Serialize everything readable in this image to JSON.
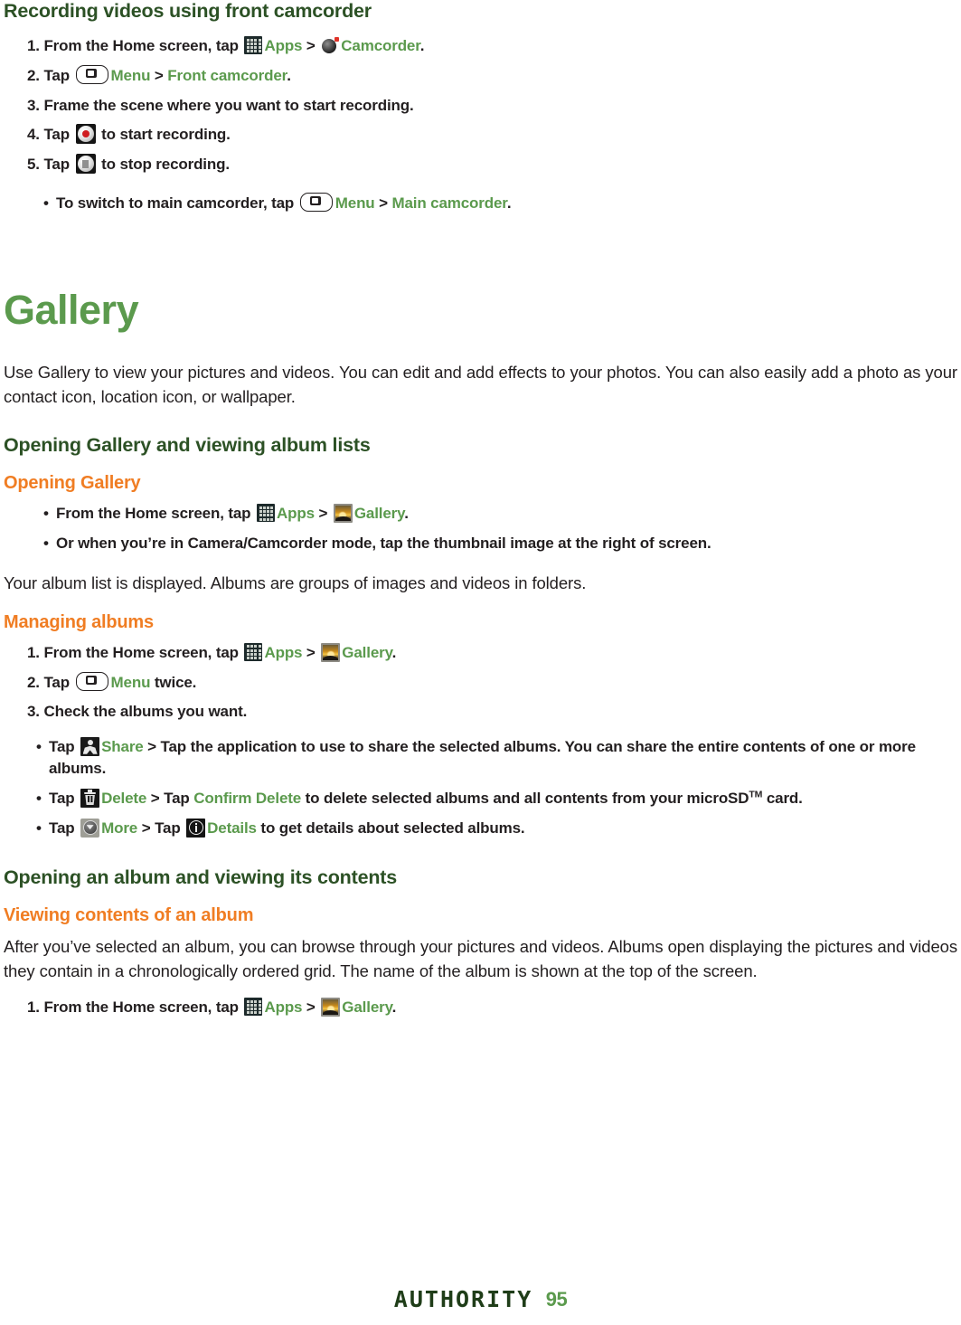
{
  "colors": {
    "heading_dark_green": "#2c5125",
    "chapter_green": "#5b9a4d",
    "orange": "#f07d23",
    "body_black": "#231f20"
  },
  "front_camcorder": {
    "heading": "Recording videos using front camcorder",
    "steps": [
      {
        "num": "1.",
        "parts": [
          {
            "t": "text",
            "v": "From the Home screen, tap "
          },
          {
            "t": "icon",
            "v": "apps-icon"
          },
          {
            "t": "green",
            "v": "Apps"
          },
          {
            "t": "sep",
            "v": " > "
          },
          {
            "t": "icon",
            "v": "camcorder-icon"
          },
          {
            "t": "green",
            "v": "Camcorder"
          },
          {
            "t": "text",
            "v": "."
          }
        ]
      },
      {
        "num": "2.",
        "parts": [
          {
            "t": "text",
            "v": "Tap "
          },
          {
            "t": "icon",
            "v": "menu-key-icon"
          },
          {
            "t": "green",
            "v": "Menu"
          },
          {
            "t": "sep",
            "v": " > "
          },
          {
            "t": "green",
            "v": "Front camcorder"
          },
          {
            "t": "text",
            "v": "."
          }
        ]
      },
      {
        "num": "3.",
        "parts": [
          {
            "t": "text",
            "v": "Frame the scene where you want to start recording."
          }
        ]
      },
      {
        "num": "4.",
        "parts": [
          {
            "t": "text",
            "v": "Tap "
          },
          {
            "t": "icon",
            "v": "record-button-icon"
          },
          {
            "t": "text",
            "v": " to start recording."
          }
        ]
      },
      {
        "num": "5.",
        "parts": [
          {
            "t": "text",
            "v": "Tap "
          },
          {
            "t": "icon",
            "v": "stop-button-icon"
          },
          {
            "t": "text",
            "v": " to stop recording."
          }
        ]
      }
    ],
    "bullet": {
      "dot": "•",
      "parts": [
        {
          "t": "text",
          "v": "To switch to main camcorder, tap "
        },
        {
          "t": "icon",
          "v": "menu-key-icon"
        },
        {
          "t": "green",
          "v": "Menu"
        },
        {
          "t": "sep",
          "v": " > "
        },
        {
          "t": "green",
          "v": "Main camcorder"
        },
        {
          "t": "text",
          "v": "."
        }
      ]
    }
  },
  "gallery": {
    "chapter_title": "Gallery",
    "intro": "Use Gallery to view your pictures and videos. You can edit and add effects to your photos. You can also easily add a photo as your contact icon, location icon, or wallpaper.",
    "section_opening": {
      "heading": "Opening Gallery and viewing album lists",
      "sub_heading": "Opening Gallery",
      "bullets": [
        {
          "dot": "•",
          "parts": [
            {
              "t": "text",
              "v": "From the Home screen, tap "
            },
            {
              "t": "icon",
              "v": "apps-icon"
            },
            {
              "t": "green",
              "v": "Apps"
            },
            {
              "t": "sep",
              "v": " > "
            },
            {
              "t": "icon",
              "v": "gallery-icon"
            },
            {
              "t": "green",
              "v": "Gallery"
            },
            {
              "t": "text",
              "v": "."
            }
          ]
        },
        {
          "dot": "•",
          "parts": [
            {
              "t": "text",
              "v": "Or when you’re in Camera/Camcorder mode, tap the thumbnail image at the right of screen."
            }
          ]
        }
      ],
      "after_text": "Your album list is displayed. Albums are groups of images and videos in folders."
    },
    "section_managing": {
      "sub_heading": "Managing albums",
      "steps": [
        {
          "num": "1.",
          "parts": [
            {
              "t": "text",
              "v": "From the Home screen, tap "
            },
            {
              "t": "icon",
              "v": "apps-icon"
            },
            {
              "t": "green",
              "v": "Apps"
            },
            {
              "t": "sep",
              "v": " > "
            },
            {
              "t": "icon",
              "v": "gallery-icon"
            },
            {
              "t": "green",
              "v": "Gallery"
            },
            {
              "t": "text",
              "v": "."
            }
          ]
        },
        {
          "num": "2.",
          "parts": [
            {
              "t": "text",
              "v": "Tap "
            },
            {
              "t": "icon",
              "v": "menu-key-icon"
            },
            {
              "t": "green",
              "v": "Menu"
            },
            {
              "t": "text",
              "v": " twice."
            }
          ]
        },
        {
          "num": "3.",
          "parts": [
            {
              "t": "text",
              "v": "Check the albums you want."
            }
          ]
        }
      ],
      "bullets": [
        {
          "dot": "•",
          "parts": [
            {
              "t": "text",
              "v": "Tap "
            },
            {
              "t": "icon",
              "v": "share-icon"
            },
            {
              "t": "green",
              "v": "Share"
            },
            {
              "t": "sep",
              "v": " > "
            },
            {
              "t": "text",
              "v": "Tap the application to use to share the selected albums. You can share the entire contents of one or more albums."
            }
          ]
        },
        {
          "dot": "•",
          "parts": [
            {
              "t": "text",
              "v": "Tap "
            },
            {
              "t": "icon",
              "v": "trash-icon"
            },
            {
              "t": "green",
              "v": "Delete"
            },
            {
              "t": "sep",
              "v": " > "
            },
            {
              "t": "text",
              "v": "Tap "
            },
            {
              "t": "green",
              "v": "Confirm Delete"
            },
            {
              "t": "text",
              "v": " to delete selected albums and all contents from your microSD"
            },
            {
              "t": "sup",
              "v": "TM"
            },
            {
              "t": "text",
              "v": " card."
            }
          ]
        },
        {
          "dot": "•",
          "parts": [
            {
              "t": "text",
              "v": "Tap "
            },
            {
              "t": "icon",
              "v": "more-icon"
            },
            {
              "t": "green",
              "v": "More"
            },
            {
              "t": "sep",
              "v": " > "
            },
            {
              "t": "text",
              "v": "Tap "
            },
            {
              "t": "icon",
              "v": "info-icon"
            },
            {
              "t": "green",
              "v": "Details"
            },
            {
              "t": "text",
              "v": " to get details about selected albums."
            }
          ]
        }
      ]
    },
    "section_album": {
      "heading": "Opening an album and viewing its contents",
      "sub_heading": "Viewing contents of an album",
      "body": "After you’ve selected an album, you can browse through your pictures and videos. Albums open displaying the pictures and videos they contain in a chronologically ordered grid. The name of the album is shown at the top of the screen.",
      "steps": [
        {
          "num": "1.",
          "parts": [
            {
              "t": "text",
              "v": "From the Home screen, tap "
            },
            {
              "t": "icon",
              "v": "apps-icon"
            },
            {
              "t": "green",
              "v": "Apps"
            },
            {
              "t": "sep",
              "v": " > "
            },
            {
              "t": "icon",
              "v": "gallery-icon"
            },
            {
              "t": "green",
              "v": "Gallery"
            },
            {
              "t": "text",
              "v": "."
            }
          ]
        }
      ]
    }
  },
  "footer": {
    "brand": "AUTHORITY",
    "page_number": "95"
  }
}
